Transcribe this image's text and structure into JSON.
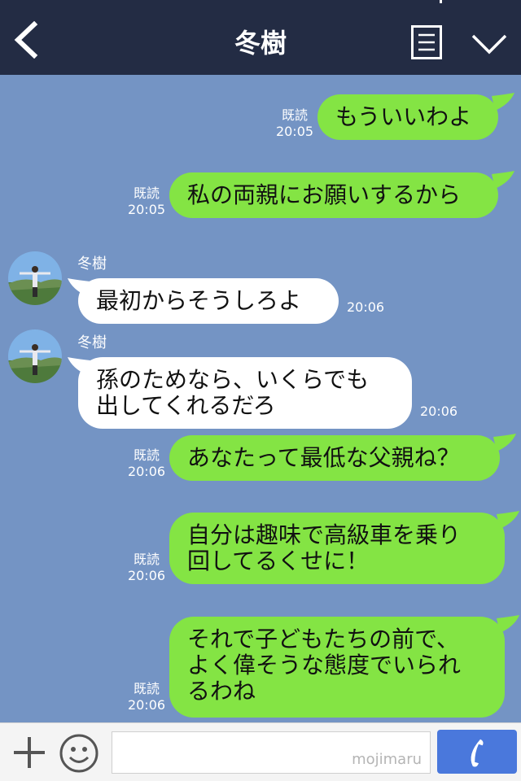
{
  "header": {
    "title": "冬樹"
  },
  "messages": [
    {
      "side": "right",
      "text": "もういいわよ",
      "read": "既読",
      "time": "20:05"
    },
    {
      "side": "right",
      "text": "私の両親にお願いするから",
      "read": "既読",
      "time": "20:05"
    },
    {
      "side": "left",
      "sender": "冬樹",
      "text": "最初からそうしろよ",
      "time": "20:06"
    },
    {
      "side": "left",
      "sender": "冬樹",
      "line1": "孫のためなら、いくらでも",
      "line2": "出してくれるだろ",
      "time": "20:06"
    },
    {
      "side": "right",
      "text": "あなたって最低な父親ね？",
      "read": "既読",
      "time": "20:06"
    },
    {
      "side": "right",
      "line1": "自分は趣味で高級車を乗り",
      "line2": "回してるくせに！",
      "read": "既読",
      "time": "20:06"
    },
    {
      "side": "right",
      "line1": "それで子どもたちの前で、",
      "line2": "よく偉そうな態度でいられ",
      "line3": "るわね",
      "read": "既読",
      "time": "20:06"
    }
  ],
  "footer": {
    "watermark": "mojimaru"
  },
  "colors": {
    "header_bg": "#232c44",
    "chat_bg": "#7494c4",
    "own_bubble": "#84e444",
    "other_bubble": "#ffffff",
    "send_button": "#4a78dc"
  },
  "icons": [
    "back-arrow-icon",
    "menu-list-icon",
    "chevron-down-icon",
    "plus-icon",
    "emoji-icon",
    "send-phone-icon"
  ]
}
